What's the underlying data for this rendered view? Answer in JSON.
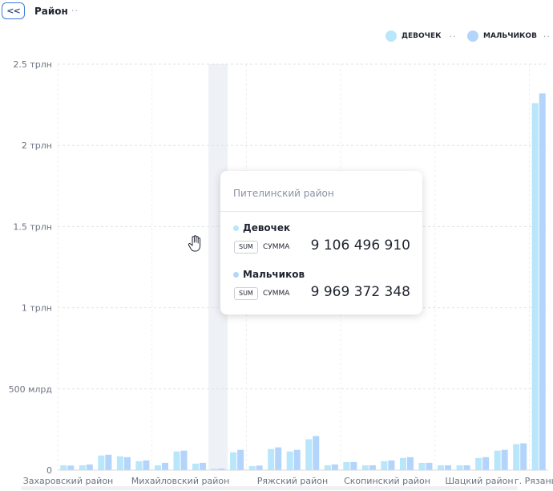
{
  "header": {
    "back_label": "<<",
    "title": "Район"
  },
  "legend": [
    {
      "label": "ДЕВОЧЕК",
      "color": "#b8e6fb"
    },
    {
      "label": "МАЛЬЧИКОВ",
      "color": "#b3d4fb"
    }
  ],
  "chart_data": {
    "type": "bar",
    "y_ticks": [
      "0",
      "500 млрд",
      "1 трлн",
      "1.5 трлн",
      "2 трлн",
      "2.5 трлн"
    ],
    "ylim": [
      0,
      2500
    ],
    "value_unit": "млрд",
    "x_labels_shown": [
      "Захаровский район",
      "Михайловский район",
      "Ряжский район",
      "Скопинский район",
      "Шацкий район",
      "г. Рязань"
    ],
    "series": [
      {
        "name": "Девочек",
        "values": [
          30,
          30,
          90,
          85,
          55,
          30,
          115,
          40,
          9,
          110,
          25,
          130,
          115,
          190,
          30,
          50,
          30,
          55,
          75,
          45,
          30,
          30,
          75,
          120,
          160,
          2260
        ]
      },
      {
        "name": "Мальчиков",
        "values": [
          28,
          35,
          95,
          80,
          60,
          45,
          120,
          45,
          10,
          125,
          28,
          140,
          125,
          210,
          35,
          50,
          30,
          60,
          80,
          45,
          30,
          30,
          80,
          125,
          165,
          2320
        ]
      }
    ],
    "highlighted_index": 8,
    "grid": true
  },
  "tooltip": {
    "title": "Пителинский район",
    "rows": [
      {
        "name": "Девочек",
        "tag": "SUM",
        "agg": "СУММА",
        "value": "9 106 496 910",
        "color": "#b8e6fb"
      },
      {
        "name": "Мальчиков",
        "tag": "SUM",
        "agg": "СУММА",
        "value": "9 969 372 348",
        "color": "#b3d4fb"
      }
    ]
  }
}
